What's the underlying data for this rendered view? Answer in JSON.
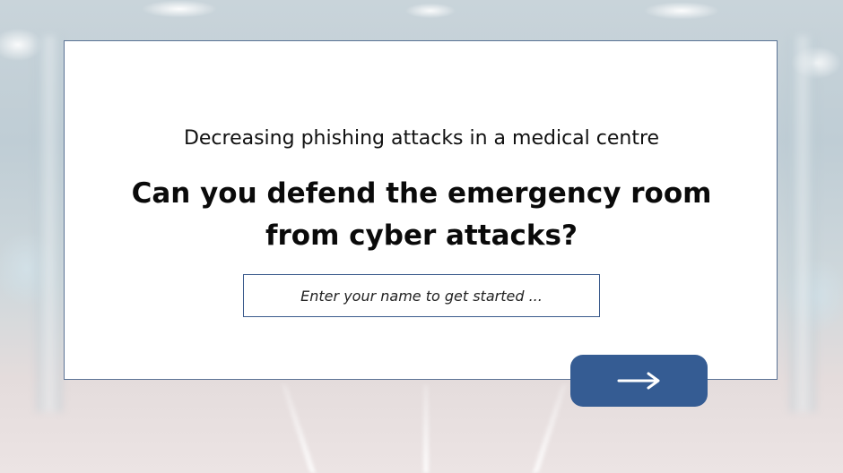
{
  "intro": {
    "subtitle": "Decreasing phishing attacks in a medical centre",
    "headline": "Can you defend the emergency room from cyber attacks?",
    "name_input": {
      "placeholder": "Enter your name to get started ...",
      "value": ""
    },
    "next_button": {
      "icon": "arrow-right-icon",
      "color": "#355c93"
    }
  }
}
